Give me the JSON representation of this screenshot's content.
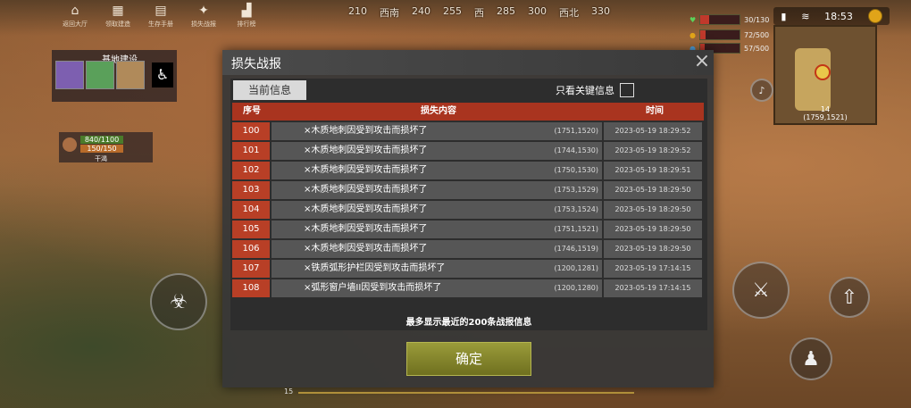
{
  "hud": {
    "nav": [
      {
        "icon": "home-icon",
        "label": "返回大厅"
      },
      {
        "icon": "building-icon",
        "label": "领取建造"
      },
      {
        "icon": "manual-icon",
        "label": "生存手册"
      },
      {
        "icon": "sparkle-icon",
        "label": "损失战报"
      },
      {
        "icon": "ranking-icon",
        "label": "排行榜"
      }
    ],
    "compass": [
      "210",
      "西南",
      "240",
      "255",
      "西",
      "285",
      "300",
      "西北",
      "330"
    ],
    "health": "30/130",
    "food": "72/500",
    "water": "57/500",
    "clock": "18:53",
    "minimap_level": "14",
    "minimap_coord": "(1759,1521)",
    "base_title": "基地建设",
    "res_1": "840/1100",
    "res_2": "150/150",
    "res_3": "干渴",
    "progress_level": "15"
  },
  "dialog": {
    "title": "损失战报",
    "tab_current": "当前信息",
    "filter_label": "只看关键信息",
    "columns": {
      "seq": "序号",
      "content": "损失内容",
      "time": "时间"
    },
    "rows": [
      {
        "seq": "100",
        "content": "×木质地刺因受到攻击而损坏了",
        "coord": "(1751,1520)",
        "time": "2023-05-19 18:29:52"
      },
      {
        "seq": "101",
        "content": "×木质地刺因受到攻击而损坏了",
        "coord": "(1744,1530)",
        "time": "2023-05-19 18:29:52"
      },
      {
        "seq": "102",
        "content": "×木质地刺因受到攻击而损坏了",
        "coord": "(1750,1530)",
        "time": "2023-05-19 18:29:51"
      },
      {
        "seq": "103",
        "content": "×木质地刺因受到攻击而损坏了",
        "coord": "(1753,1529)",
        "time": "2023-05-19 18:29:50"
      },
      {
        "seq": "104",
        "content": "×木质地刺因受到攻击而损坏了",
        "coord": "(1753,1524)",
        "time": "2023-05-19 18:29:50"
      },
      {
        "seq": "105",
        "content": "×木质地刺因受到攻击而损坏了",
        "coord": "(1751,1521)",
        "time": "2023-05-19 18:29:50"
      },
      {
        "seq": "106",
        "content": "×木质地刺因受到攻击而损坏了",
        "coord": "(1746,1519)",
        "time": "2023-05-19 18:29:50"
      },
      {
        "seq": "107",
        "content": "×铁质弧形护栏因受到攻击而损坏了",
        "coord": "(1200,1281)",
        "time": "2023-05-19 17:14:15"
      },
      {
        "seq": "108",
        "content": "×弧形窗户墙II因受到攻击而损坏了",
        "coord": "(1200,1280)",
        "time": "2023-05-19 17:14:15"
      }
    ],
    "note": "最多显示最近的200条战报信息",
    "confirm": "确定"
  },
  "colors": {
    "header": "#a9341f",
    "seq": "#b83f26",
    "confirm": "#8b8c2e"
  }
}
